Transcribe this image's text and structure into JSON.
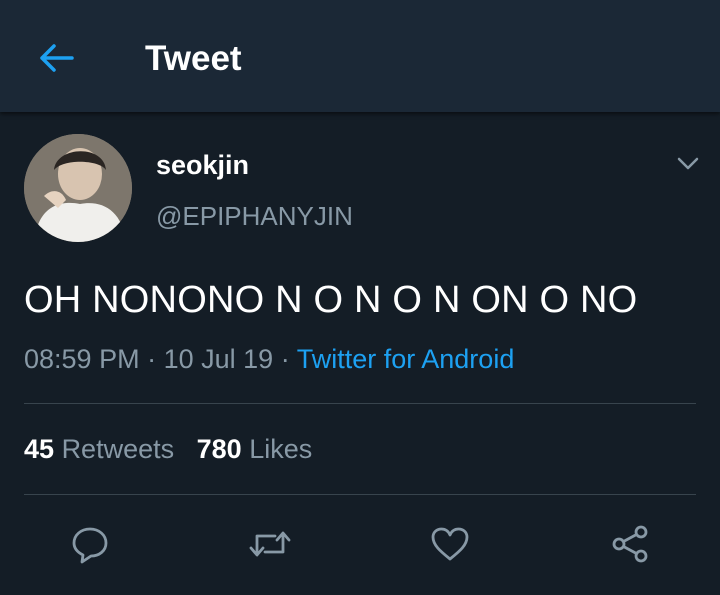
{
  "header": {
    "title": "Tweet"
  },
  "tweet": {
    "display_name": "seokjin",
    "handle": "@EPIPHANYJIN",
    "text": "OH NONONO N O N O N ON O NO",
    "time": "08:59 PM",
    "date": "10 Jul 19",
    "source": "Twitter for Android",
    "separator": "·"
  },
  "stats": {
    "retweets_count": "45",
    "retweets_label": "Retweets",
    "likes_count": "780",
    "likes_label": "Likes"
  },
  "icons": {
    "back": "arrow-left-icon",
    "more": "chevron-down-icon",
    "reply": "reply-icon",
    "retweet": "retweet-icon",
    "like": "heart-icon",
    "share": "share-icon"
  },
  "colors": {
    "background": "#141d26",
    "header": "#1b2836",
    "accent": "#1da1f2",
    "secondary_text": "#8899a6",
    "divider": "#38444d"
  }
}
